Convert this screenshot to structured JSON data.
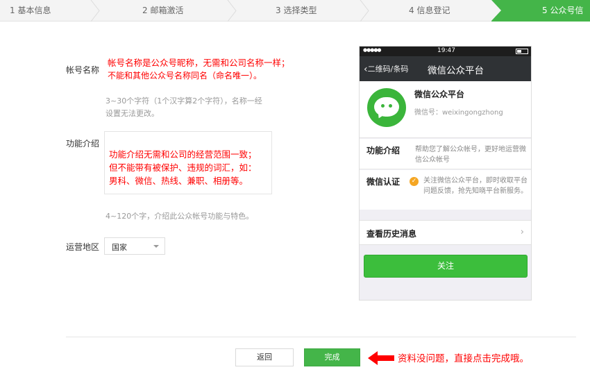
{
  "steps": [
    {
      "label": "1 基本信息"
    },
    {
      "label": "2 邮箱激活"
    },
    {
      "label": "3 选择类型"
    },
    {
      "label": "4 信息登记"
    },
    {
      "label": "5 公众号信息"
    }
  ],
  "form": {
    "account_name": {
      "label": "帐号名称",
      "note_line1": "帐号名称是公众号昵称，无需和公司名称一样；",
      "note_line2": "不能和其他公众号名称同名（命名唯一）。",
      "hint_line1": "3~30个字符（1个汉字算2个字符），名称一经",
      "hint_line2": "设置无法更改。"
    },
    "intro": {
      "label": "功能介绍",
      "note_line1": "功能介绍无需和公司的经营范围一致；",
      "note_line2": "但不能带有被保护、违规的词汇，如：",
      "note_line3": "男科、微信、热线、兼职、相册等。",
      "hint": "4~120个字，介绍此公众帐号功能与特色。"
    },
    "region": {
      "label": "运营地区",
      "value": "国家"
    }
  },
  "phone": {
    "status_signal": "●●●●●",
    "status_time": "19:47",
    "nav_back": "二维码/条码",
    "nav_title": "微信公众平台",
    "profile_name": "微信公众平台",
    "profile_id": "微信号：weixingongzhong",
    "intro_label": "功能介绍",
    "intro_text": "帮助您了解公众帐号，更好地运营微信公众帐号",
    "verify_label": "微信认证",
    "verify_text": "关注微信公众平台，即时收取平台问题反馈，抢先知晓平台新服务。",
    "history_label": "查看历史消息",
    "follow_label": "关注"
  },
  "footer": {
    "back_label": "返回",
    "done_label": "完成",
    "annotation": "资料没问题，直接点击完成哦。"
  },
  "colors": {
    "accent_green": "#44b549",
    "annotation_red": "#ff0000"
  }
}
